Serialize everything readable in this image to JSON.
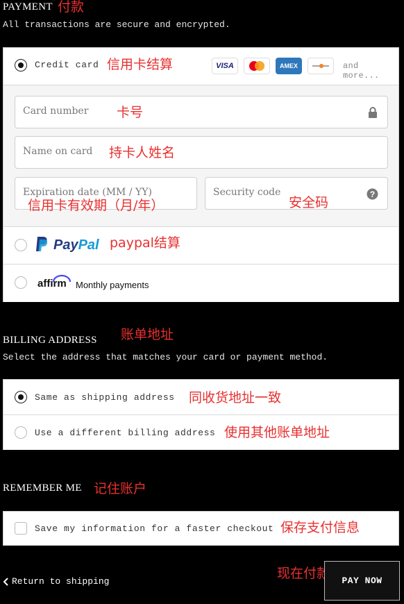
{
  "payment": {
    "heading": "PAYMENT",
    "heading_note": "付款",
    "subtitle": "All transactions are secure and encrypted.",
    "credit_card": {
      "label": "Credit card",
      "note": "信用卡结算",
      "logos": [
        "VISA",
        "Mastercard",
        "AMEX",
        "Discover"
      ],
      "and_more": "and more...",
      "card_number_placeholder": "Card number",
      "card_number_note": "卡号",
      "name_placeholder": "Name on card",
      "name_note": "持卡人姓名",
      "expiration_placeholder": "Expiration date (MM / YY)",
      "expiration_note": "信用卡有效期（月/年）",
      "security_placeholder": "Security code",
      "security_note": "安全码"
    },
    "paypal": {
      "brand_pay": "Pay",
      "brand_pal": "Pal",
      "note": "paypal结算"
    },
    "affirm": {
      "brand": "affirm",
      "label": "Monthly payments"
    }
  },
  "billing": {
    "heading": "BILLING ADDRESS",
    "heading_note": "账单地址",
    "subtitle": "Select the address that matches your card or payment method.",
    "options": [
      {
        "label": "Same as shipping address",
        "note": "同收货地址一致",
        "selected": true
      },
      {
        "label": "Use a different billing address",
        "note": "使用其他账单地址",
        "selected": false
      }
    ]
  },
  "remember": {
    "heading": "REMEMBER ME",
    "heading_note": "记住账户",
    "checkbox_label": "Save my information for a faster checkout",
    "checkbox_note": "保存支付信息"
  },
  "footer": {
    "return_label": "Return to shipping",
    "pay_label": "PAY NOW",
    "pay_note": "现在付款"
  },
  "colors": {
    "annotation": "#e8302f",
    "paypal_dark": "#253b80",
    "paypal_light": "#179bd7",
    "amex": "#2e77bb"
  }
}
